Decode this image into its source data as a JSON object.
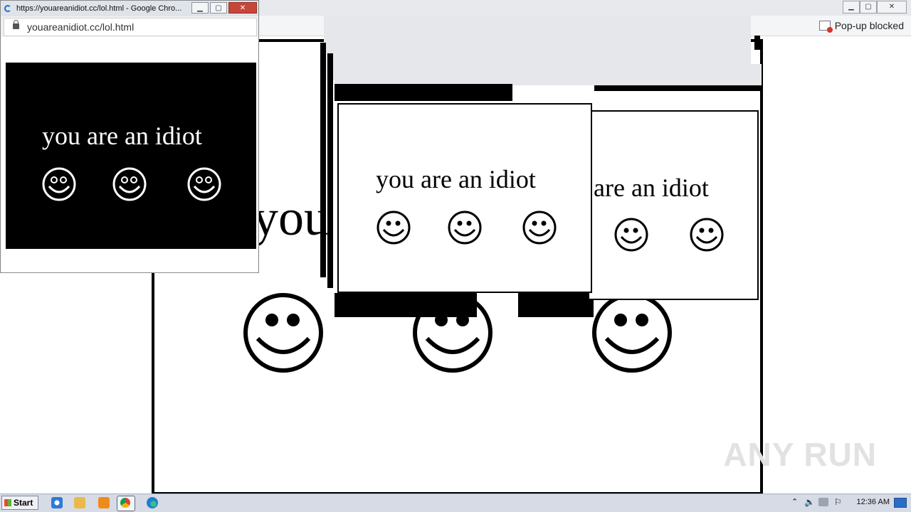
{
  "background_browser": {
    "popup_blocked_label": "Pop-up blocked",
    "big_text": "you"
  },
  "popup_window": {
    "title": "https://youareanidiot.cc/lol.html - Google Chro...",
    "url": "youareanidiot.cc/lol.html",
    "message": "you are an idiot",
    "controls": {
      "minimize": "▁",
      "maximize": "▢",
      "close": "✕"
    }
  },
  "center_window": {
    "message": "you are an idiot"
  },
  "right_window": {
    "message": "are an idiot"
  },
  "watermark": "ANY RUN",
  "taskbar": {
    "start_label": "Start",
    "clock": "12:36 AM",
    "items": [
      "ie-icon",
      "explorer-icon",
      "media-player-icon",
      "chrome-icon",
      "edge-icon"
    ]
  },
  "colors": {
    "brand_close": "#c7463a",
    "taskbar": "#d6dbe5",
    "popup_bg": "#000000"
  }
}
